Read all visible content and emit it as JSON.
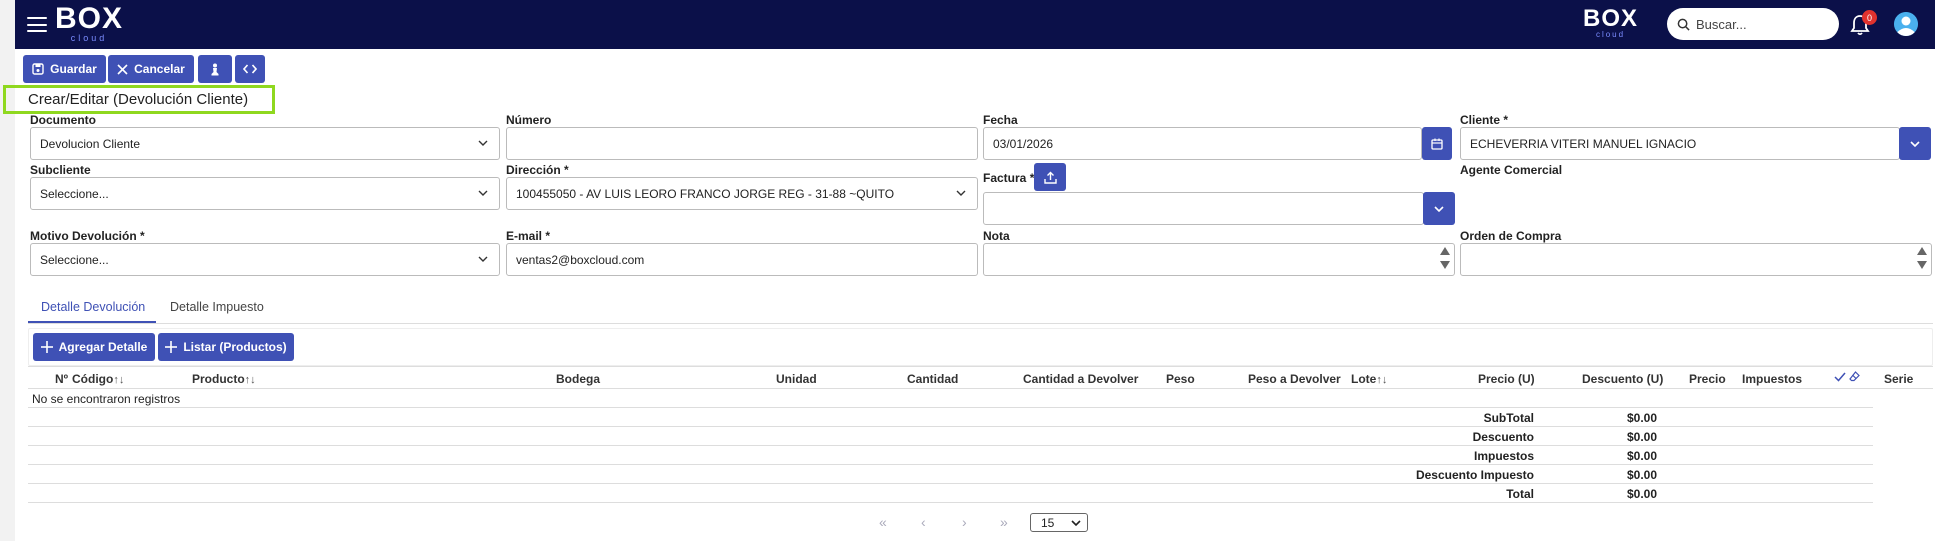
{
  "header": {
    "logo_text": "BOX",
    "logo_sub": "cloud",
    "search_placeholder": "Buscar...",
    "notifications_count": "0"
  },
  "toolbar": {
    "save_label": "Guardar",
    "cancel_label": "Cancelar"
  },
  "page_title": "Crear/Editar (Devolución Cliente)",
  "form": {
    "documento": {
      "label": "Documento",
      "value": "Devolucion Cliente"
    },
    "numero": {
      "label": "Número",
      "value": ""
    },
    "fecha": {
      "label": "Fecha",
      "value": "03/01/2026"
    },
    "cliente": {
      "label": "Cliente",
      "required": "*",
      "value": "ECHEVERRIA VITERI MANUEL IGNACIO"
    },
    "subcliente": {
      "label": "Subcliente",
      "value": "Seleccione..."
    },
    "direccion": {
      "label": "Dirección",
      "required": "*",
      "value": "100455050 - AV LUIS LEORO FRANCO JORGE REG - 31-88 ~QUITO"
    },
    "factura": {
      "label": "Factura",
      "required": "*",
      "value": ""
    },
    "agente": {
      "label": "Agente Comercial"
    },
    "motivo": {
      "label": "Motivo Devolución",
      "required": "*",
      "value": "Seleccione..."
    },
    "email": {
      "label": "E-mail",
      "required": "*",
      "value": "ventas2@boxcloud.com"
    },
    "nota": {
      "label": "Nota",
      "value": ""
    },
    "orden_compra": {
      "label": "Orden de Compra",
      "value": ""
    }
  },
  "tabs": [
    {
      "label": "Detalle Devolución",
      "active": true
    },
    {
      "label": "Detalle Impuesto",
      "active": false
    }
  ],
  "detail_toolbar": {
    "add_label": "Agregar Detalle",
    "list_label": "Listar (Productos)"
  },
  "table": {
    "columns": [
      "Nº",
      "Código",
      "Producto",
      "Bodega",
      "Unidad",
      "Cantidad",
      "Cantidad a Devolver",
      "Peso",
      "Peso a Devolver",
      "Lote",
      "Precio (U)",
      "Descuento (U)",
      "Precio",
      "Impuestos",
      "Serie"
    ],
    "sort_glyph": "↑↓",
    "empty_message": "No se encontraron registros"
  },
  "totals": [
    {
      "label": "SubTotal",
      "value": "$0.00"
    },
    {
      "label": "Descuento",
      "value": "$0.00"
    },
    {
      "label": "Impuestos",
      "value": "$0.00"
    },
    {
      "label": "Descuento Impuesto",
      "value": "$0.00"
    },
    {
      "label": "Total",
      "value": "$0.00"
    }
  ],
  "pagination": {
    "first": "«",
    "prev": "‹",
    "next": "›",
    "last": "»",
    "page_size": "15"
  },
  "colors": {
    "navbar": "#0b1049",
    "primary": "#3f51b5",
    "title_highlight": "#8fd81f",
    "badge": "#e0322e"
  }
}
